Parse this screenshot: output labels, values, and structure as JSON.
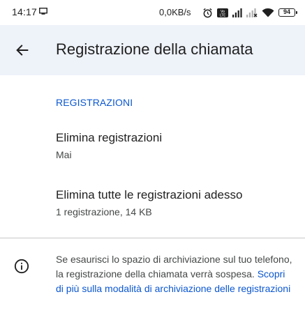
{
  "status_bar": {
    "time": "14:17",
    "network_speed": "0,0KB/s",
    "battery_level": "94",
    "icons": [
      "screen-cast-icon",
      "alarm-icon",
      "volte-icon",
      "signal-icon",
      "signal-off-icon",
      "wifi-icon",
      "battery-icon"
    ]
  },
  "app_bar": {
    "back_icon": "arrow-back-icon",
    "title": "Registrazione della chiamata",
    "background": "#eef2f9"
  },
  "section": {
    "header": "REGISTRAZIONI",
    "accent_color": "#0b57d0"
  },
  "items": [
    {
      "title": "Elimina registrazioni",
      "subtitle": "Mai"
    },
    {
      "title": "Elimina tutte le registrazioni adesso",
      "subtitle": "1 registrazione, 14 KB"
    }
  ],
  "info": {
    "icon": "info-icon",
    "text": "Se esaurisci lo spazio di archiviazione sul tuo telefono, la registrazione della chiamata verrà sospesa. ",
    "link_text": "Scopri di più sulla modalità di archiviazione delle registrazioni"
  }
}
